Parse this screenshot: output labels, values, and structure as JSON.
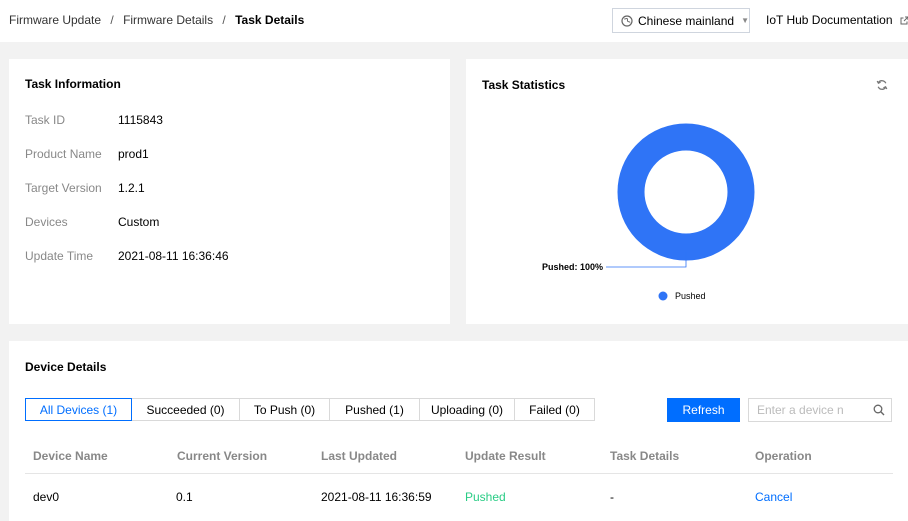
{
  "breadcrumb": {
    "items": [
      "Firmware Update",
      "Firmware Details"
    ],
    "separator": "/",
    "current": "Task Details"
  },
  "header": {
    "region_select": {
      "value": "Chinese mainland",
      "icon": "globe-icon"
    },
    "doc_link": {
      "label": "IoT Hub Documentation",
      "icon": "external-link-icon"
    }
  },
  "task_info": {
    "title": "Task Information",
    "rows": [
      {
        "label": "Task ID",
        "value": "1115843"
      },
      {
        "label": "Product Name",
        "value": "prod1"
      },
      {
        "label": "Target Version",
        "value": "1.2.1"
      },
      {
        "label": "Devices",
        "value": "Custom"
      },
      {
        "label": "Update Time",
        "value": "2021-08-11 16:36:46"
      }
    ]
  },
  "task_stats": {
    "title": "Task Statistics",
    "refresh_icon": "refresh-icon",
    "callout": "Pushed: 100%"
  },
  "chart_data": {
    "type": "pie",
    "title": "",
    "categories": [
      "Pushed"
    ],
    "values": [
      100
    ],
    "legend": {
      "entries": [
        "Pushed"
      ],
      "placement": "bottom"
    },
    "colors": [
      "#2f74f6"
    ]
  },
  "device_details": {
    "title": "Device Details",
    "tabs": [
      {
        "label": "All Devices (1)",
        "active": true
      },
      {
        "label": "Succeeded (0)",
        "active": false
      },
      {
        "label": "To Push (0)",
        "active": false
      },
      {
        "label": "Pushed (1)",
        "active": false
      },
      {
        "label": "Uploading (0)",
        "active": false
      },
      {
        "label": "Failed (0)",
        "active": false
      }
    ],
    "refresh_button": "Refresh",
    "search": {
      "placeholder": "Enter a device n",
      "value": ""
    },
    "columns": [
      "Device Name",
      "Current Version",
      "Last Updated",
      "Update Result",
      "Task Details",
      "Operation"
    ],
    "rows": [
      {
        "device_name": "dev0",
        "current_version": "0.1",
        "last_updated": "2021-08-11 16:36:59",
        "update_result": "Pushed",
        "task_details": "-",
        "operation": "Cancel"
      }
    ]
  },
  "colors": {
    "accent": "#006eff",
    "chart_blue": "#2f74f6",
    "success_green": "#29cc85",
    "background": "#f2f2f2"
  }
}
